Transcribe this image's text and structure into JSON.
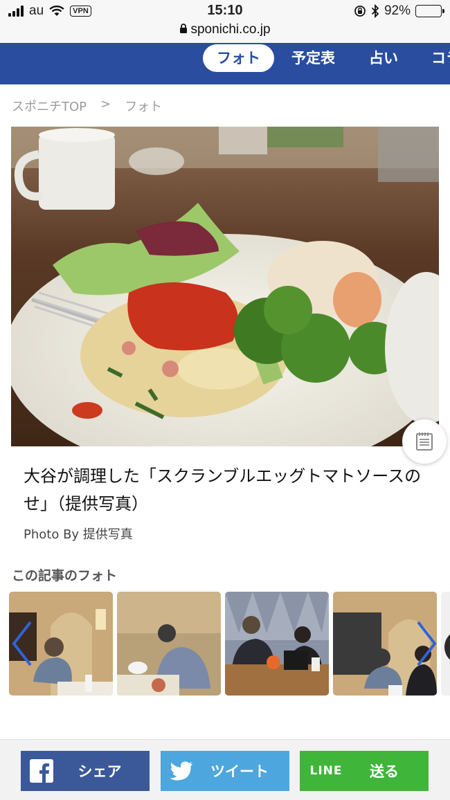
{
  "status_bar": {
    "carrier": "au",
    "vpn": "VPN",
    "time": "15:10",
    "url": "sponichi.co.jp",
    "battery": "92%",
    "battery_level": 0.92
  },
  "nav": {
    "tabs": [
      {
        "label": "フォト",
        "active": true
      },
      {
        "label": "予定表",
        "active": false
      },
      {
        "label": "占い",
        "active": false
      },
      {
        "label": "コラ",
        "active": false
      }
    ]
  },
  "breadcrumb": {
    "home": "スポニチTOP",
    "separator": ">",
    "current": "フォト"
  },
  "photo": {
    "caption": "大谷が調理した「スクランブルエッグトマトソースのせ」（提供写真）",
    "credit": "Photo By 提供写真"
  },
  "related": {
    "title": "この記事のフォト"
  },
  "share": {
    "facebook_label": "シェア",
    "twitter_label": "ツイート",
    "line_icon": "LINE",
    "line_label": "送る"
  },
  "colors": {
    "nav_blue": "#2a4da0",
    "facebook": "#3b5998",
    "twitter": "#4da7de",
    "line": "#3fb53a"
  }
}
